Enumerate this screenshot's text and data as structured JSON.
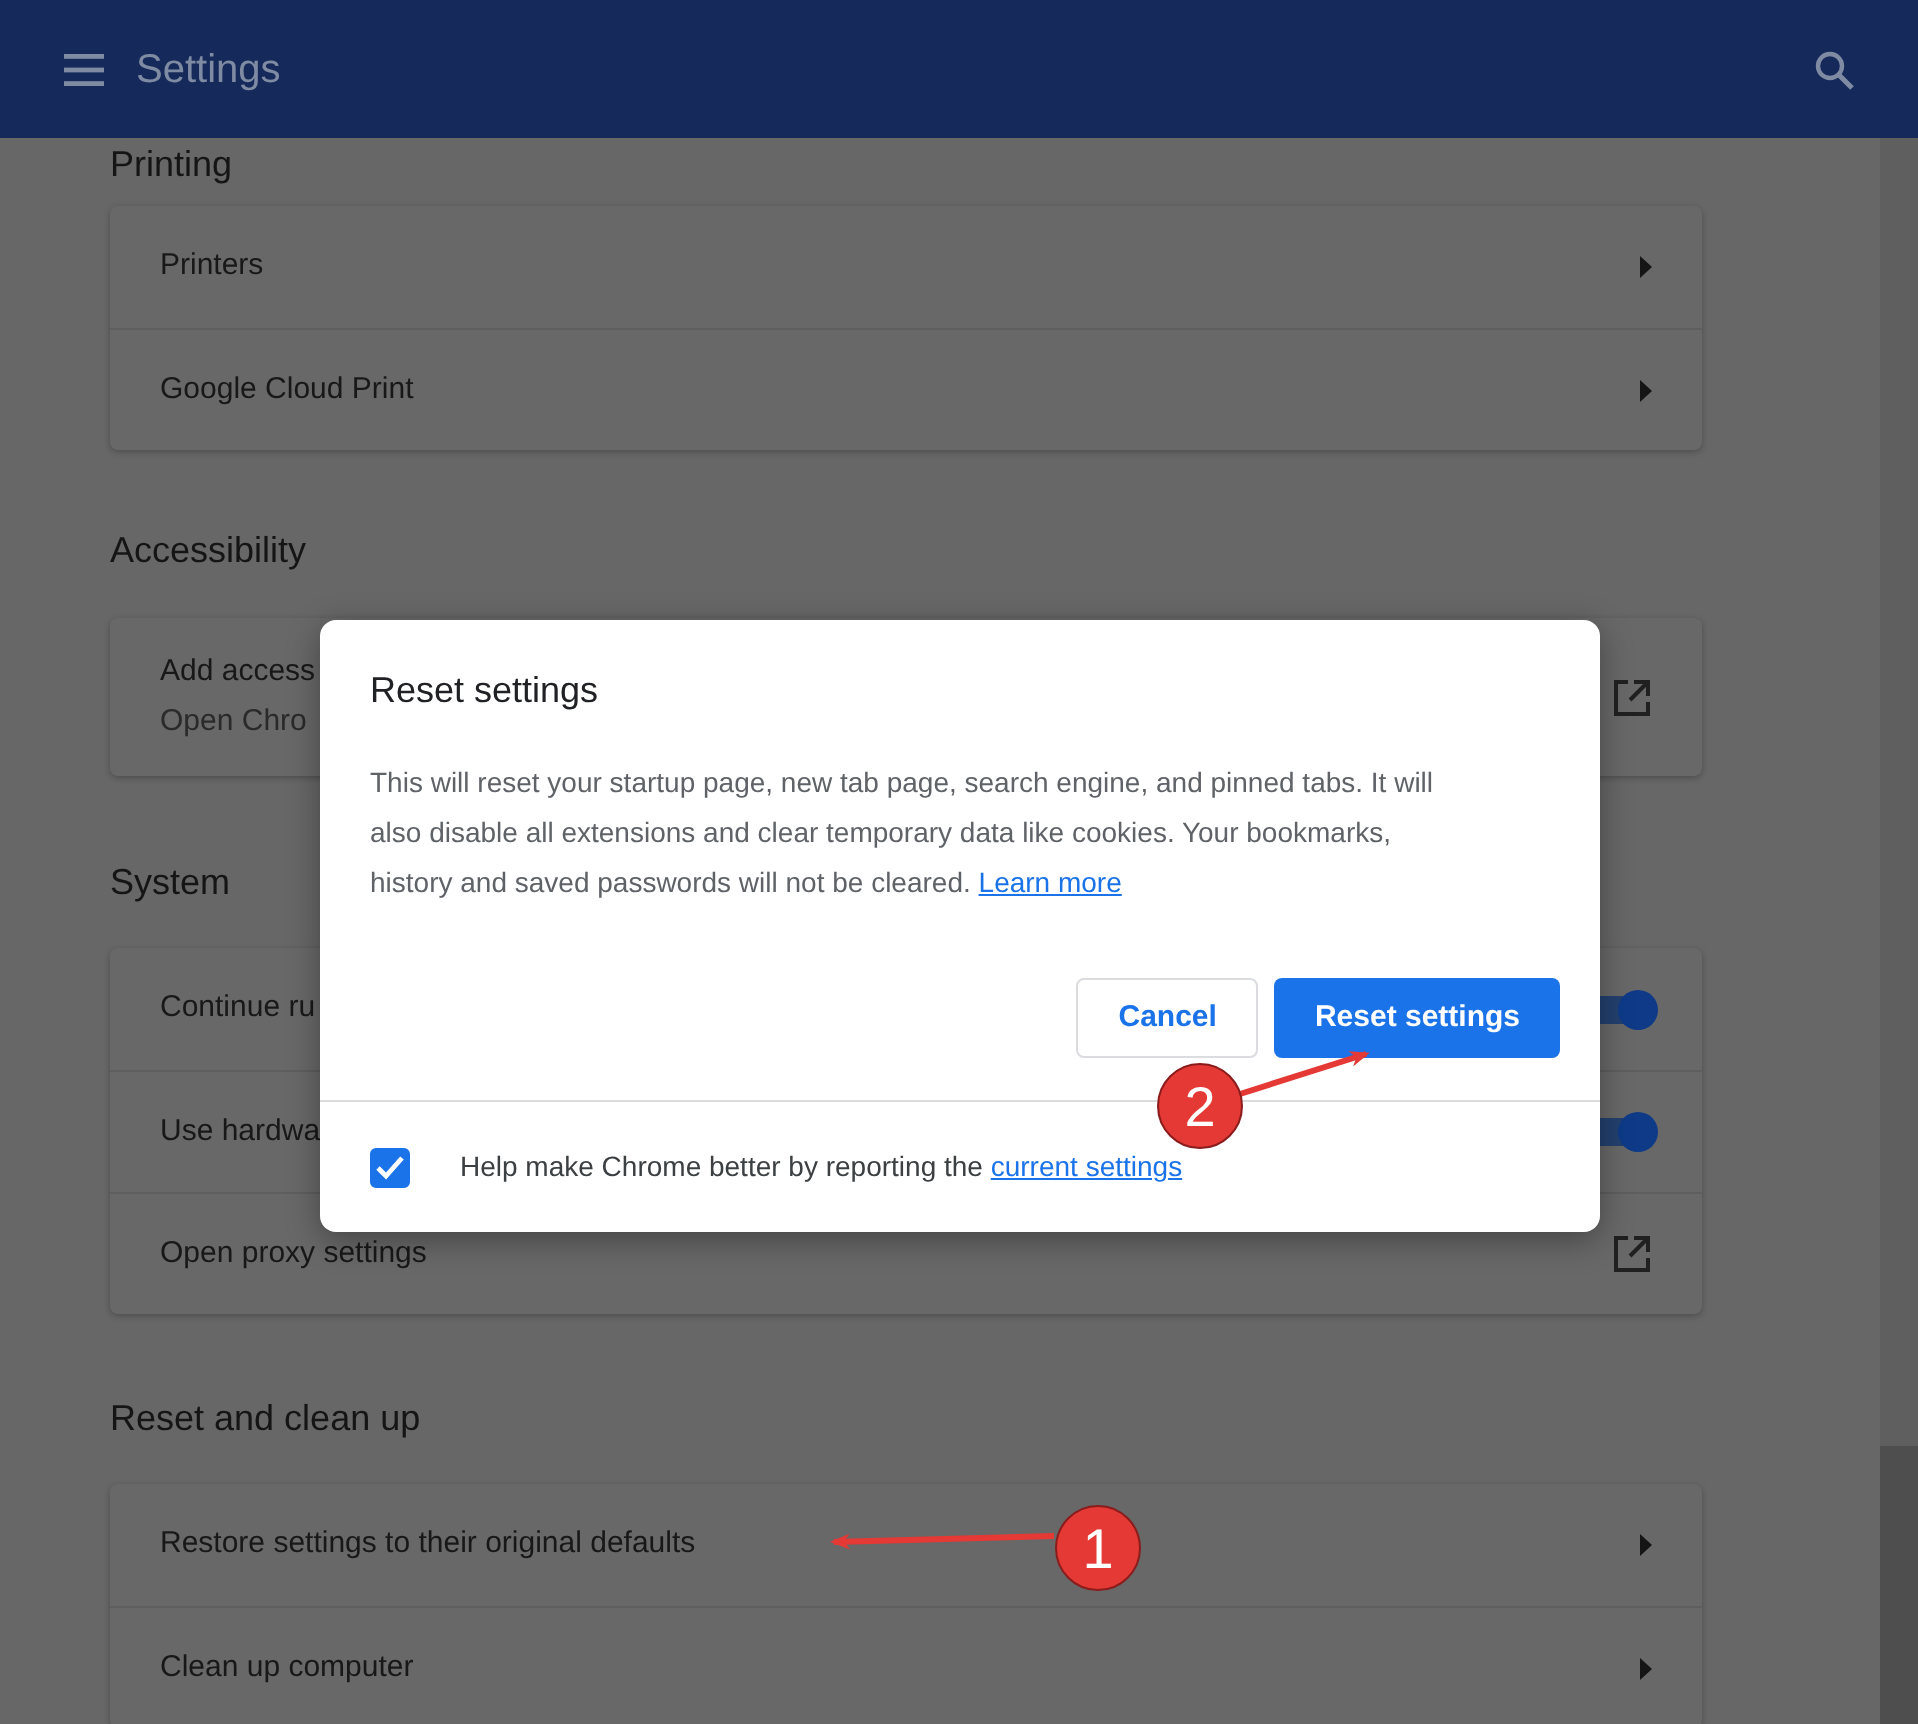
{
  "header": {
    "title": "Settings"
  },
  "sections": [
    {
      "title": "Printing",
      "rows": [
        {
          "kind": "arrow",
          "label": "Printers"
        },
        {
          "kind": "arrow",
          "label": "Google Cloud Print"
        }
      ]
    },
    {
      "title": "Accessibility",
      "rows": [
        {
          "kind": "external",
          "label": "Add access",
          "sublabel": "Open Chro"
        }
      ]
    },
    {
      "title": "System",
      "rows": [
        {
          "kind": "toggle",
          "label": "Continue ru",
          "on": true
        },
        {
          "kind": "toggle",
          "label": "Use hardwa",
          "on": true
        },
        {
          "kind": "external",
          "label": "Open proxy settings"
        }
      ]
    },
    {
      "title": "Reset and clean up",
      "rows": [
        {
          "kind": "arrow",
          "label": "Restore settings to their original defaults"
        },
        {
          "kind": "arrow",
          "label": "Clean up computer"
        }
      ]
    }
  ],
  "dialog": {
    "title": "Reset settings",
    "body": "This will reset your startup page, new tab page, search engine, and pinned tabs. It will also disable all extensions and clear temporary data like cookies. Your bookmarks, history and saved passwords will not be cleared.",
    "body_link": "Learn more",
    "buttons": [
      {
        "label": "Cancel",
        "kind": "secondary"
      },
      {
        "label": "Reset settings",
        "kind": "primary"
      }
    ],
    "footer": {
      "checked": true,
      "text": "Help make Chrome better by reporting the",
      "link": "current settings"
    }
  },
  "annotations": [
    "1",
    "2"
  ]
}
